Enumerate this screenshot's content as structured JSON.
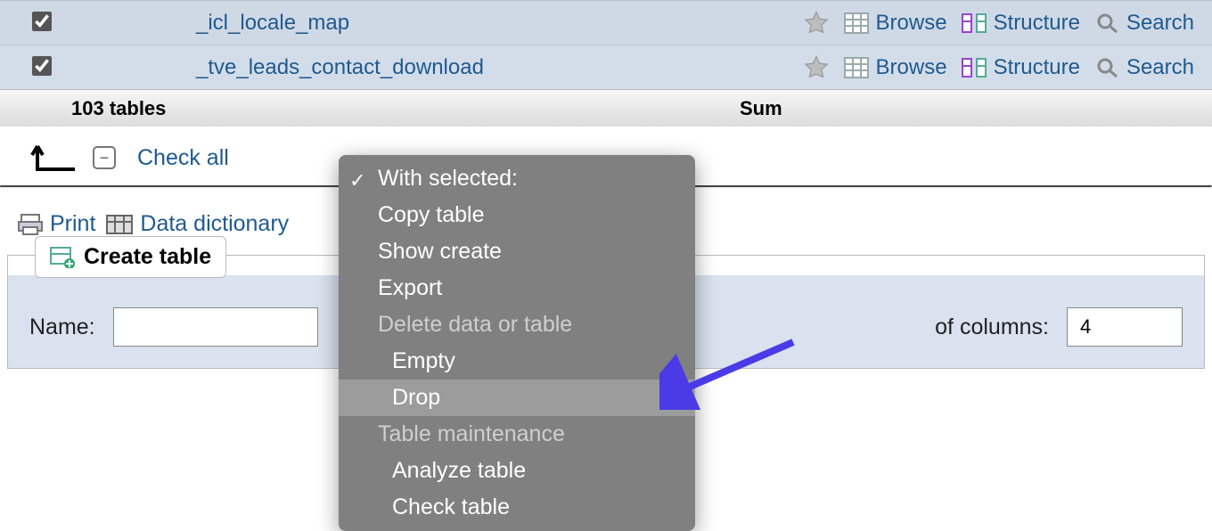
{
  "rows": [
    {
      "name": "_icl_locale_map"
    },
    {
      "name": "_tve_leads_contact_download"
    }
  ],
  "actions": {
    "browse": "Browse",
    "structure": "Structure",
    "search": "Search"
  },
  "summary": {
    "count": "103 tables",
    "sum": "Sum"
  },
  "checkall": {
    "label": "Check all"
  },
  "util": {
    "print": "Print",
    "dictionary": "Data dictionary"
  },
  "create": {
    "button": "Create table",
    "name_label": "Name:",
    "name_value": "",
    "columns_label": "of columns:",
    "columns_value": "4"
  },
  "dropdown": {
    "selected": "With selected:",
    "copy": "Copy table",
    "show_create": "Show create",
    "export": "Export",
    "header_delete": "Delete data or table",
    "empty": "Empty",
    "drop": "Drop",
    "header_maint": "Table maintenance",
    "analyze": "Analyze table",
    "check": "Check table"
  }
}
